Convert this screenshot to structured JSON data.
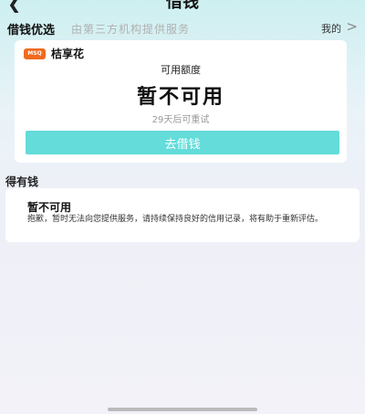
{
  "nav": {
    "back_icon": "chevron-left-icon",
    "title": "借钱"
  },
  "section": {
    "title": "借钱优选",
    "subtitle": "由第三方机构提供服务",
    "my_link": "我的",
    "my_link_icon": "chevron-right-icon"
  },
  "product": {
    "logo_text": "MSQ",
    "logo_color": "#f06a1f",
    "name": "桔享花",
    "quota_label": "可用额度",
    "quota_value": "暂不可用",
    "retry_note": "29天后可重试",
    "button_label": "去借钱",
    "button_color": "#63dcda"
  },
  "section2": {
    "title": "得有钱"
  },
  "notice": {
    "title": "暂不可用",
    "body": "抱歉，暂时无法向您提供服务，请持续保持良好的信用记录，将有助于重新评估。"
  }
}
